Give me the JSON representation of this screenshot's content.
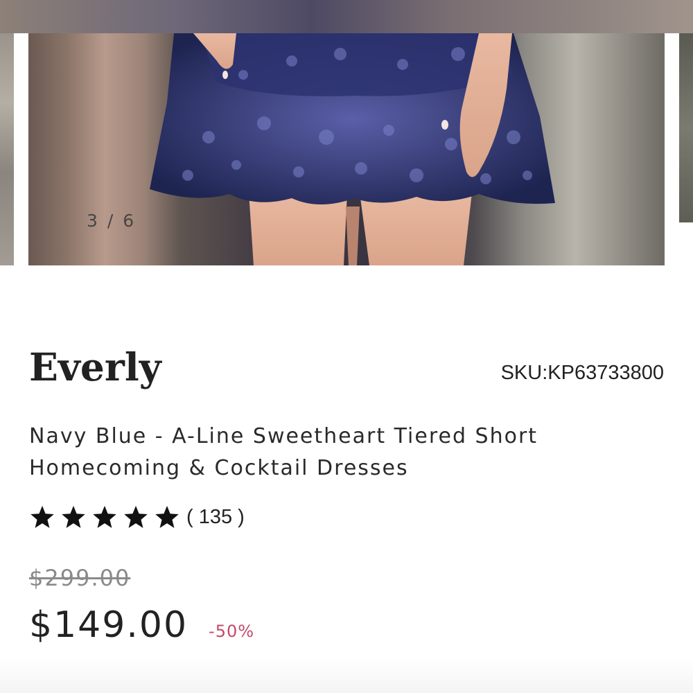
{
  "gallery": {
    "counter": "3 / 6",
    "current": 3,
    "total": 6,
    "images": [
      {
        "name": "navy-sequin-dress-skirt-photo"
      }
    ]
  },
  "product": {
    "brand": "Everly",
    "sku": "SKU:KP63733800",
    "name_line1": "Navy Blue - A-Line Sweetheart Tiered Short",
    "name_line2": "Homecoming & Cocktail Dresses",
    "rating": {
      "stars": 5,
      "max": 5,
      "count_text": "( 135 )"
    },
    "price": {
      "original": "$299.00",
      "current": "$149.00",
      "discount": "-50%"
    }
  },
  "colors": {
    "discount": "#c24a68",
    "text": "#222222",
    "muted": "#8a8a8a"
  },
  "icons": [
    "star-icon"
  ]
}
